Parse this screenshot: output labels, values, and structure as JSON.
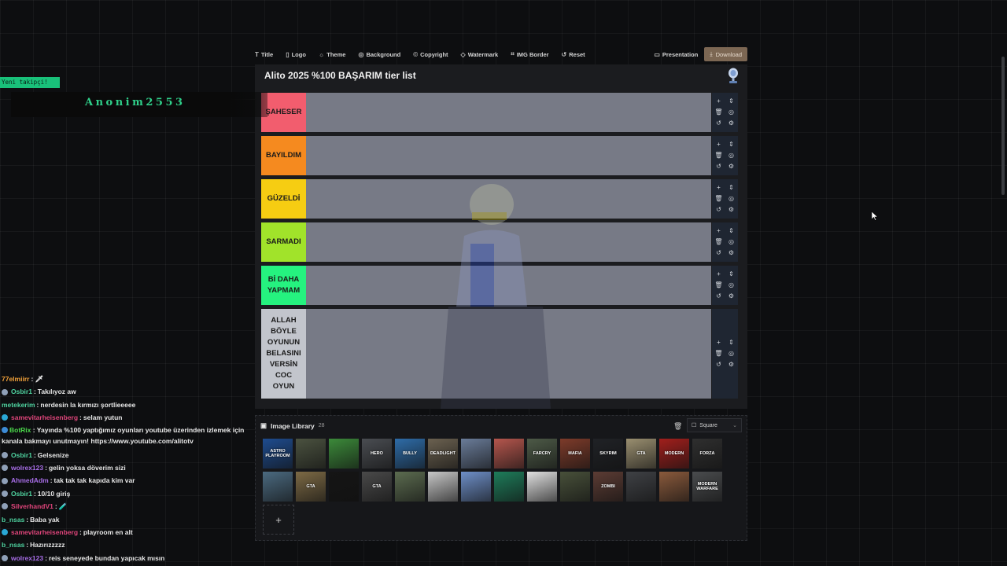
{
  "toolbar": {
    "items": [
      {
        "label": "Title",
        "icon": "text-icon"
      },
      {
        "label": "Logo",
        "icon": "file-icon"
      },
      {
        "label": "Theme",
        "icon": "sun-icon"
      },
      {
        "label": "Background",
        "icon": "palette-icon"
      },
      {
        "label": "Copyright",
        "icon": "copyright-icon"
      },
      {
        "label": "Watermark",
        "icon": "shield-icon"
      },
      {
        "label": "IMG Border",
        "icon": "frame-icon"
      },
      {
        "label": "Reset",
        "icon": "reset-icon"
      }
    ],
    "presentation": "Presentation",
    "download": "Download"
  },
  "tierlist": {
    "title": "Alito 2025 %100 BAŞARIM tier list",
    "tiers": [
      {
        "label": "ŞAHESER",
        "color": "#f25d6e"
      },
      {
        "label": "BAYILDIM",
        "color": "#f58a1f"
      },
      {
        "label": "GÜZELDİ",
        "color": "#f6cd12"
      },
      {
        "label": "SARMADI",
        "color": "#a1e32a"
      },
      {
        "label": "Bİ DAHA YAPMAM",
        "color": "#25f27f"
      },
      {
        "label": "ALLAH BÖYLE OYUNUN BELASINI VERSİN COC OYUN",
        "color": "#c2c5cc"
      }
    ]
  },
  "library": {
    "title": "Image Library",
    "count": "28",
    "shape": "Square",
    "thumbs": [
      {
        "label": "ASTRO PLAYROOM",
        "color": "#1e4c8f"
      },
      {
        "label": "",
        "color": "#4b5240"
      },
      {
        "label": "",
        "color": "#3c8a3a"
      },
      {
        "label": "HERO",
        "color": "#4a4d52"
      },
      {
        "label": "BULLY",
        "color": "#2e6ca8"
      },
      {
        "label": "DEADLIGHT",
        "color": "#6b6150"
      },
      {
        "label": "",
        "color": "#6a7c99"
      },
      {
        "label": "",
        "color": "#b5564d"
      },
      {
        "label": "FARCRY",
        "color": "#4d5a47"
      },
      {
        "label": "MAFIA",
        "color": "#7d3b2a"
      },
      {
        "label": "SKYRIM",
        "color": "#202226"
      },
      {
        "label": "GTA",
        "color": "#9a8f70"
      },
      {
        "label": "MODERN",
        "color": "#a11f1c"
      },
      {
        "label": "FORZA",
        "color": "#2f2f2f"
      },
      {
        "label": "",
        "color": "#4b6a80"
      },
      {
        "label": "GTA",
        "color": "#7d6a45"
      },
      {
        "label": "",
        "color": "#151515"
      },
      {
        "label": "GTA",
        "color": "#4a4a4a"
      },
      {
        "label": "",
        "color": "#5c6c50"
      },
      {
        "label": "",
        "color": "#c7c7c7"
      },
      {
        "label": "",
        "color": "#6e8fc8"
      },
      {
        "label": "",
        "color": "#1e7c5a"
      },
      {
        "label": "",
        "color": "#e0e0e0"
      },
      {
        "label": "",
        "color": "#48503a"
      },
      {
        "label": "ZOMBI",
        "color": "#5c3c34"
      },
      {
        "label": "",
        "color": "#3f4145"
      },
      {
        "label": "",
        "color": "#8a5a3c"
      },
      {
        "label": "MODERN WARFARE",
        "color": "#4a4c4e"
      }
    ]
  },
  "overlay": {
    "follower_badge": "Yeni takipçi!",
    "follower_name": "Anonim2553"
  },
  "chat": [
    {
      "user": "77elmiirr",
      "text": "🗡",
      "color": "#f2a23a",
      "badge": ""
    },
    {
      "user": "Osbir1",
      "text": "Takılıyoz aw",
      "color": "#4fd3a0",
      "badge": "#8fa0b8"
    },
    {
      "user": "metekerim",
      "text": "nerdesin la kırmızı şortlieeeee",
      "color": "#4fd3a0",
      "badge": ""
    },
    {
      "user": "samevitarheisenberg",
      "text": "selam yutun",
      "color": "#e0457b",
      "badge": "#2aa8d6"
    },
    {
      "user": "BotRix",
      "text": "Yayında %100 yaptığımız oyunları youtube üzerinden izlemek için kanala bakmayı unutmayın! https://www.youtube.com/alitotv",
      "color": "#4ad94a",
      "badge": "#3d8bd6"
    },
    {
      "user": "Osbir1",
      "text": "Gelsenize",
      "color": "#4fd3a0",
      "badge": "#8fa0b8"
    },
    {
      "user": "wolrex123",
      "text": "gelin yoksa döverim sizi",
      "color": "#a86ee8",
      "badge": "#8fa0b8"
    },
    {
      "user": "AhmedAdm",
      "text": "tak tak tak kapıda kim var",
      "color": "#a86ee8",
      "badge": "#8fa0b8"
    },
    {
      "user": "Osbir1",
      "text": "10/10 giriş",
      "color": "#4fd3a0",
      "badge": "#8fa0b8"
    },
    {
      "user": "SilverhandV1",
      "text": "🧪",
      "color": "#e0457b",
      "badge": "#8fa0b8"
    },
    {
      "user": "b_nsas",
      "text": "Baba yak",
      "color": "#4fd3a0",
      "badge": ""
    },
    {
      "user": "samevitarheisenberg",
      "text": "playroom en alt",
      "color": "#e0457b",
      "badge": "#2aa8d6"
    },
    {
      "user": "b_nsas",
      "text": "Hazırızzzzz",
      "color": "#4fd3a0",
      "badge": ""
    },
    {
      "user": "wolrex123",
      "text": "reis seneyede bundan yapıcak mısın",
      "color": "#a86ee8",
      "badge": "#8fa0b8"
    }
  ]
}
